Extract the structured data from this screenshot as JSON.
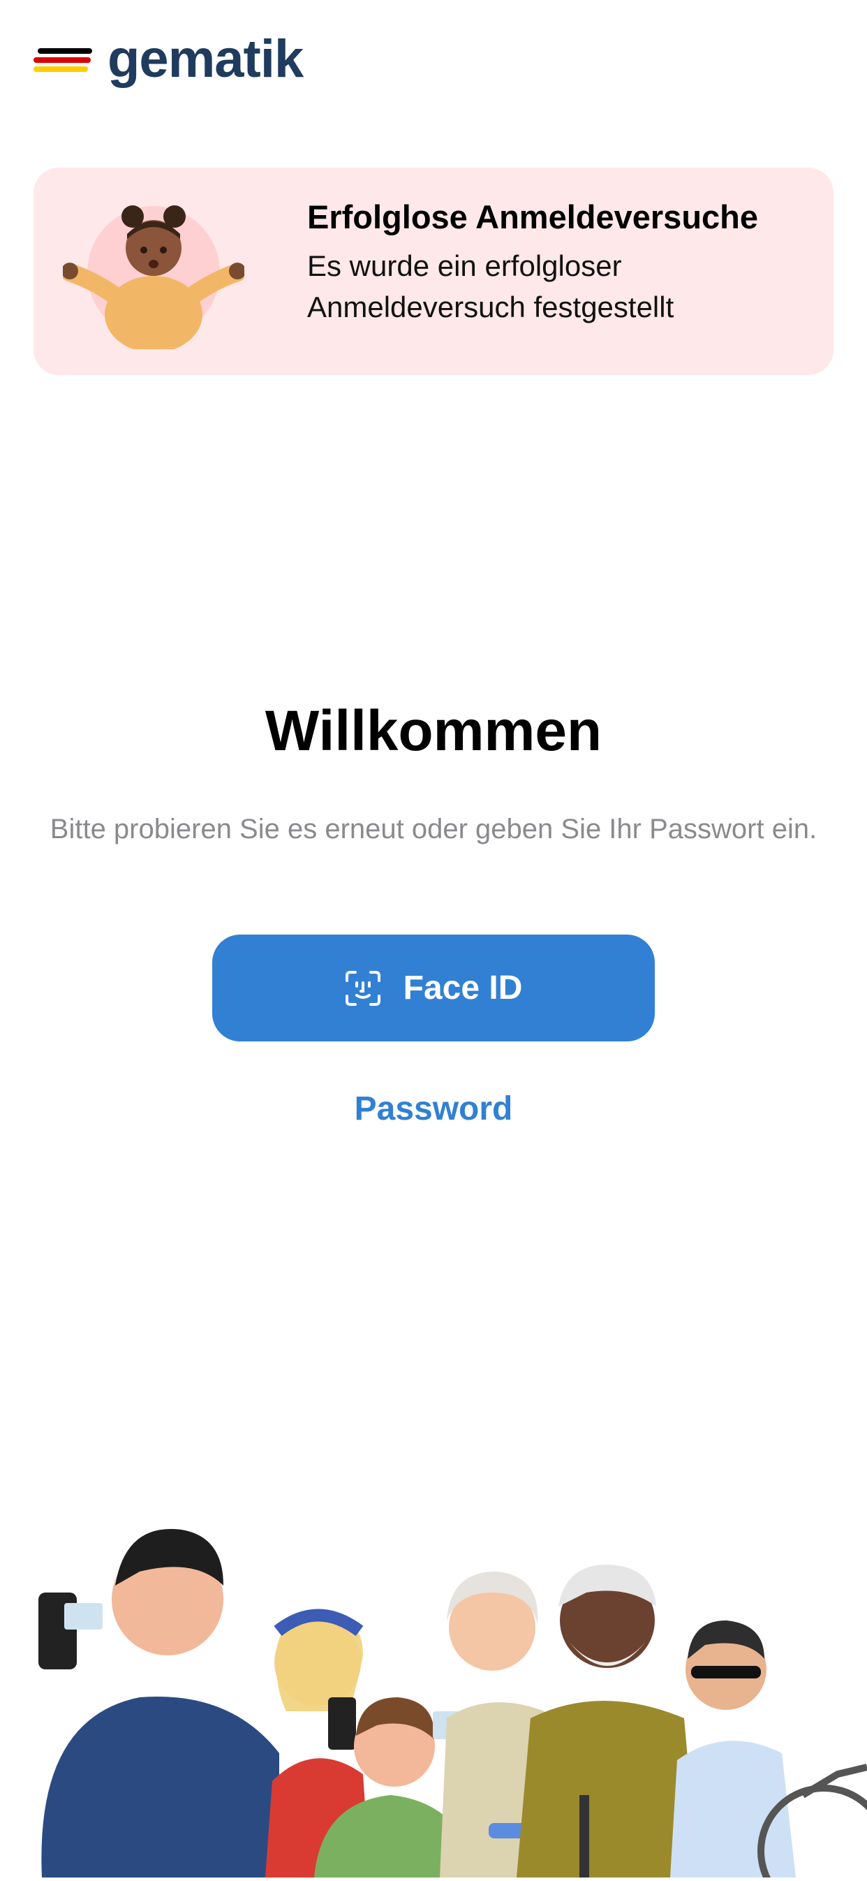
{
  "brand": {
    "name": "gematik",
    "flag_colors": [
      "#000000",
      "#dd0000",
      "#ffce00"
    ],
    "color": "#1f3b5e"
  },
  "banner": {
    "title": "Erfolglose Anmeldeversuche",
    "message": "Es wurde ein erfolgloser Anmeldeversuch festgestellt",
    "background": "#ffe8e9",
    "illustration": "shrugging-girl-illustration"
  },
  "welcome": {
    "title": "Willkommen",
    "subtitle": "Bitte probieren Sie es erneut oder geben Sie Ihr Passwort ein."
  },
  "actions": {
    "faceid_label": "Face ID",
    "faceid_icon": "faceid-icon",
    "password_label": "Password",
    "accent": "#3180d3"
  },
  "footer": {
    "illustration": "diverse-people-group-illustration"
  }
}
